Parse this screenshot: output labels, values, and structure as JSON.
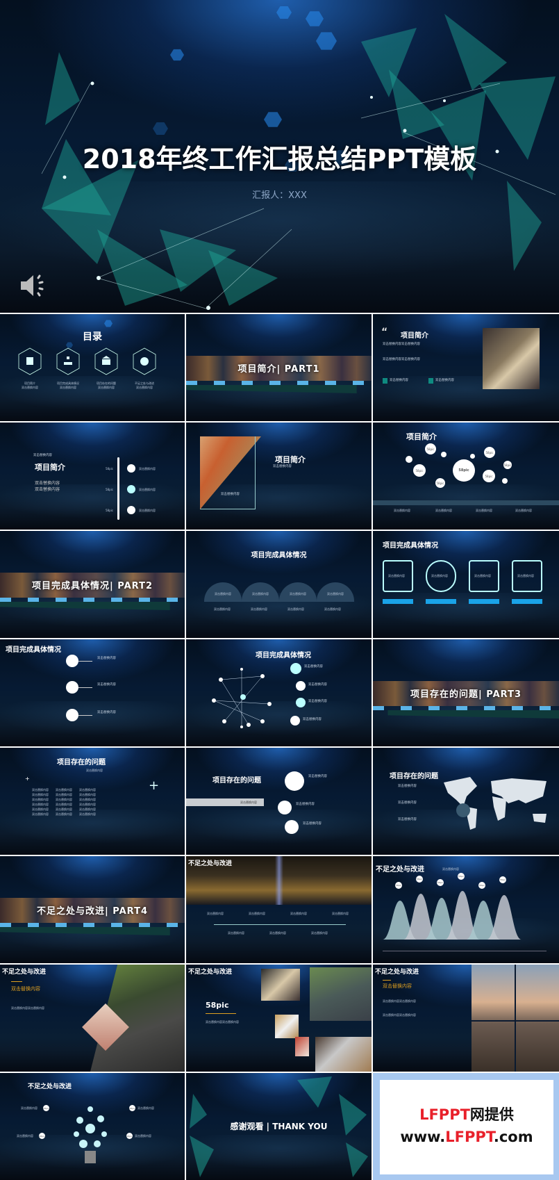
{
  "cover": {
    "title": "2018年终工作汇报总结PPT模板",
    "reporter": "汇报人：XXX",
    "audio_icon": "speaker-icon"
  },
  "placeholder": "双击替换内容",
  "placeholder_long": "双击替换内容双击替换内容",
  "pic_tag": "58pic",
  "toc": {
    "title": "目录",
    "items": [
      {
        "label": "项目简介",
        "icon": "calendar-icon"
      },
      {
        "label": "项目完成具体情况",
        "icon": "org-chart-icon"
      },
      {
        "label": "项目存在的问题",
        "icon": "bank-icon"
      },
      {
        "label": "不足之处与改进",
        "icon": "globe-icon"
      }
    ]
  },
  "sections": {
    "part1": "项目简介| PART1",
    "part2": "项目完成具体情况| PART2",
    "part3": "项目存在的问题| PART3",
    "part4": "不足之处与改进| PART4"
  },
  "titles": {
    "intro": "项目简介",
    "done": "项目完成具体情况",
    "problems": "项目存在的问题",
    "improve": "不足之处与改进"
  },
  "thanks": "感谢观看 | THANK YOU",
  "watermark": {
    "line1_brand": "LFPPT",
    "line1_rest": "网提供",
    "line2_pre": "www.",
    "line2_brand": "LFPPT",
    "line2_post": ".com",
    "brand_color": "#e8202a"
  },
  "colors": {
    "accent": "#1aa3e8",
    "teal": "#0f8a80",
    "gold": "#e0a020"
  }
}
